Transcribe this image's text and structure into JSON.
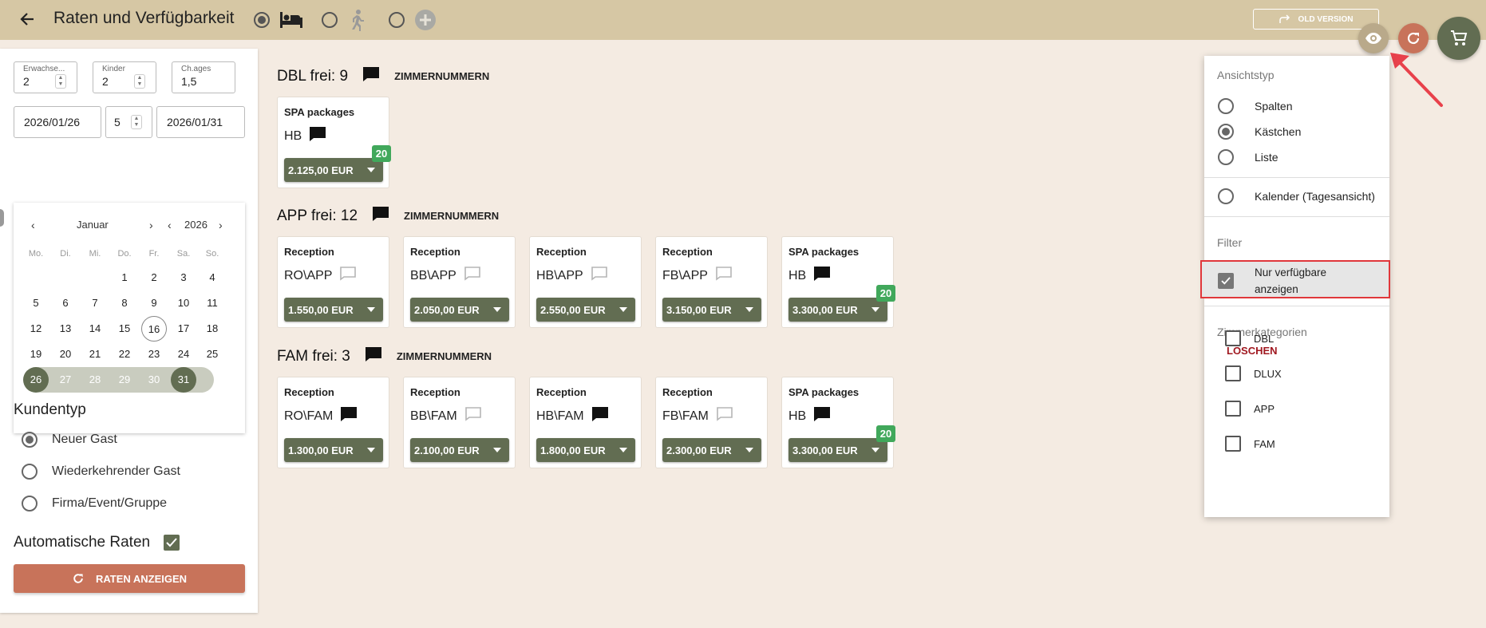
{
  "header": {
    "title": "Raten und Verfügbarkeit",
    "old_version_label": "OLD VERSION",
    "modes": [
      {
        "icon": "bed-icon",
        "selected": true
      },
      {
        "icon": "walking-person-icon",
        "selected": false
      },
      {
        "icon": "plus-circle-icon",
        "selected": false
      }
    ]
  },
  "guests": {
    "adults_label": "Erwachse...",
    "adults_value": "2",
    "children_label": "Kinder",
    "children_value": "2",
    "child_ages_label": "Ch.ages",
    "child_ages_value": "1,5"
  },
  "stay": {
    "arrival": "2026/01/26",
    "nights": "5",
    "departure": "2026/01/31"
  },
  "calendar": {
    "month": "Januar",
    "year": "2026",
    "weekdays": [
      "Mo.",
      "Di.",
      "Mi.",
      "Do.",
      "Fr.",
      "Sa.",
      "So."
    ],
    "weeks": [
      [
        "",
        "",
        "",
        "1",
        "2",
        "3",
        "4"
      ],
      [
        "5",
        "6",
        "7",
        "8",
        "9",
        "10",
        "11"
      ],
      [
        "12",
        "13",
        "14",
        "15",
        "16",
        "17",
        "18"
      ],
      [
        "19",
        "20",
        "21",
        "22",
        "23",
        "24",
        "25"
      ],
      [
        "26",
        "27",
        "28",
        "29",
        "30",
        "31",
        ""
      ]
    ],
    "today": "16",
    "range_start": "26",
    "range_end": "31"
  },
  "customer_type": {
    "title": "Kundentyp",
    "options": [
      {
        "label": "Neuer Gast",
        "selected": true
      },
      {
        "label": "Wiederkehrender Gast",
        "selected": false
      },
      {
        "label": "Firma/Event/Gruppe",
        "selected": false
      }
    ]
  },
  "auto_rates": {
    "label": "Automatische Raten",
    "checked": true,
    "button_label": "RATEN ANZEIGEN"
  },
  "categories": [
    {
      "title": "DBL frei: 9",
      "rooms_label": "ZIMMERNUMMERN",
      "rates": [
        {
          "source": "SPA packages",
          "plan": "HB",
          "note_filled": true,
          "price": "2.125,00 EUR",
          "badge": "20"
        }
      ]
    },
    {
      "title": "APP frei: 12",
      "rooms_label": "ZIMMERNUMMERN",
      "rates": [
        {
          "source": "Reception",
          "plan": "RO\\APP",
          "note_filled": false,
          "price": "1.550,00 EUR",
          "badge": ""
        },
        {
          "source": "Reception",
          "plan": "BB\\APP",
          "note_filled": false,
          "price": "2.050,00 EUR",
          "badge": ""
        },
        {
          "source": "Reception",
          "plan": "HB\\APP",
          "note_filled": false,
          "price": "2.550,00 EUR",
          "badge": ""
        },
        {
          "source": "Reception",
          "plan": "FB\\APP",
          "note_filled": false,
          "price": "3.150,00 EUR",
          "badge": ""
        },
        {
          "source": "SPA packages",
          "plan": "HB",
          "note_filled": true,
          "price": "3.300,00 EUR",
          "badge": "20"
        }
      ]
    },
    {
      "title": "FAM frei: 3",
      "rooms_label": "ZIMMERNUMMERN",
      "rates": [
        {
          "source": "Reception",
          "plan": "RO\\FAM",
          "note_filled": true,
          "price": "1.300,00 EUR",
          "badge": ""
        },
        {
          "source": "Reception",
          "plan": "BB\\FAM",
          "note_filled": false,
          "price": "2.100,00 EUR",
          "badge": ""
        },
        {
          "source": "Reception",
          "plan": "HB\\FAM",
          "note_filled": true,
          "price": "1.800,00 EUR",
          "badge": ""
        },
        {
          "source": "Reception",
          "plan": "FB\\FAM",
          "note_filled": false,
          "price": "2.300,00 EUR",
          "badge": ""
        },
        {
          "source": "SPA packages",
          "plan": "HB",
          "note_filled": true,
          "price": "3.300,00 EUR",
          "badge": "20"
        }
      ]
    }
  ],
  "view_panel": {
    "view_type_label": "Ansichtstyp",
    "view_options": [
      {
        "label": "Spalten",
        "selected": false
      },
      {
        "label": "Kästchen",
        "selected": true
      },
      {
        "label": "Liste",
        "selected": false
      },
      {
        "label": "Kalender (Tagesansicht)",
        "selected": false
      }
    ],
    "filter_label": "Filter",
    "filter_option_line1": "Nur verfügbare",
    "filter_option_line2": "anzeigen",
    "filter_checked": true,
    "room_categories_label": "Zimmerkategorien",
    "clear_label": "LÖSCHEN",
    "room_categories": [
      "DBL",
      "DLUX",
      "APP",
      "FAM"
    ]
  },
  "colors": {
    "header_bg": "#d6c7a4",
    "accent_green": "#626d52",
    "accent_terracotta": "#c8735a",
    "badge_green": "#41a85b",
    "highlight_red": "#e0373b",
    "page_bg": "#f4ebe2"
  }
}
